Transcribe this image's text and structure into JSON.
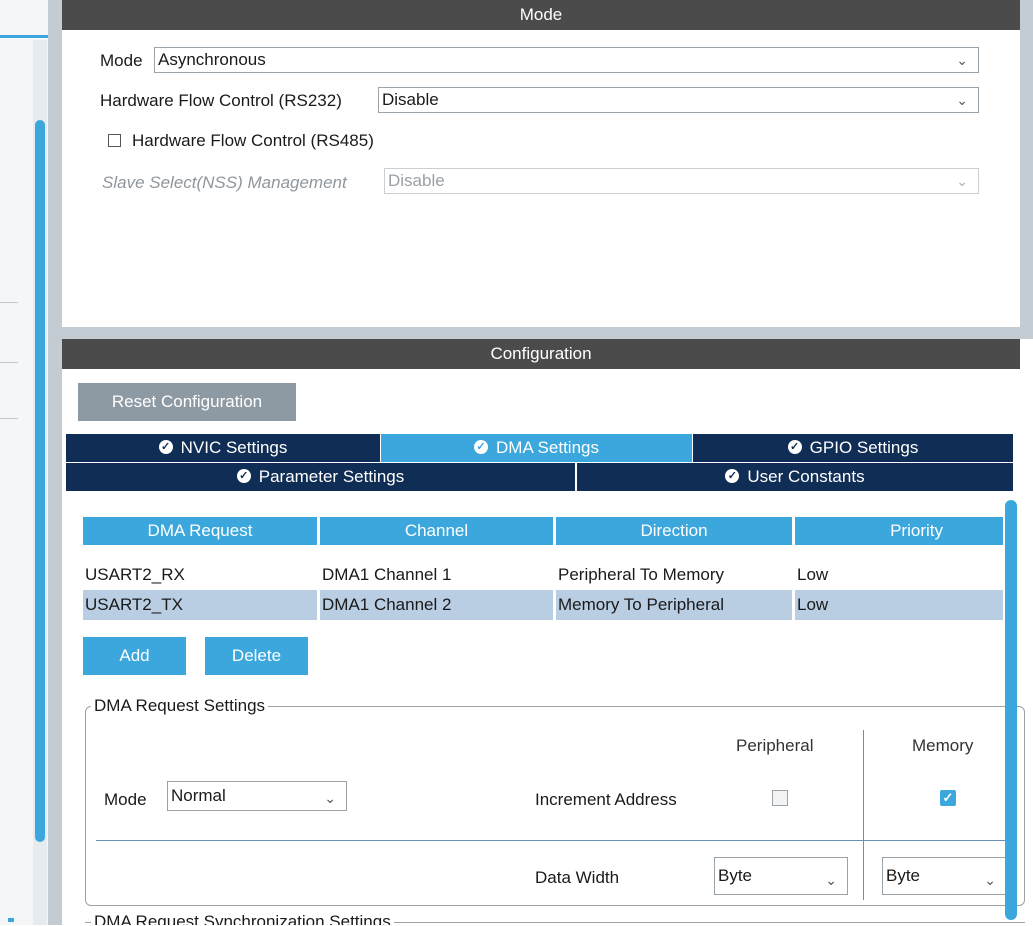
{
  "mode_panel": {
    "header": "Mode",
    "mode_label": "Mode",
    "mode_value": "Asynchronous",
    "hfc_rs232_label": "Hardware Flow Control (RS232)",
    "hfc_rs232_value": "Disable",
    "hfc_rs485_label": "Hardware Flow Control (RS485)",
    "hfc_rs485_checked": false,
    "nss_label": "Slave Select(NSS) Management",
    "nss_value": "Disable"
  },
  "config_panel": {
    "header": "Configuration",
    "reset_button": "Reset Configuration",
    "tabs_row1": [
      "NVIC Settings",
      "DMA Settings",
      "GPIO Settings"
    ],
    "tabs_row2": [
      "Parameter Settings",
      "User Constants"
    ],
    "active_tab": "DMA Settings",
    "table": {
      "headers": [
        "DMA Request",
        "Channel",
        "Direction",
        "Priority"
      ],
      "rows": [
        [
          "USART2_RX",
          "DMA1 Channel 1",
          "Peripheral To Memory",
          "Low"
        ],
        [
          "USART2_TX",
          "DMA1 Channel 2",
          "Memory To Peripheral",
          "Low"
        ]
      ],
      "selected_row": 1
    },
    "add_button": "Add",
    "delete_button": "Delete",
    "dma_request_settings": {
      "title": "DMA Request Settings",
      "peripheral_header": "Peripheral",
      "memory_header": "Memory",
      "mode_label": "Mode",
      "mode_value": "Normal",
      "increment_label": "Increment Address",
      "peripheral_increment": false,
      "memory_increment": true,
      "data_width_label": "Data Width",
      "peripheral_width": "Byte",
      "memory_width": "Byte"
    },
    "sync_settings_title": "DMA Request Synchronization Settings"
  },
  "colors": {
    "accent": "#3ba7dc",
    "header_bg": "#4b4b4b",
    "tab_bg": "#0f2d55",
    "selected_row": "#b9cde3"
  }
}
